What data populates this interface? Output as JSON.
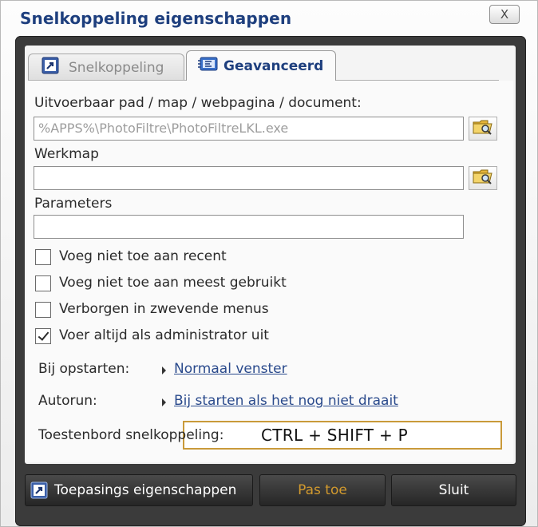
{
  "window": {
    "title": "Snelkoppeling eigenschappen",
    "close_label": "X"
  },
  "tabs": [
    {
      "label": "Snelkoppeling",
      "icon": "shortcut-arrow-icon",
      "active": false
    },
    {
      "label": "Geavanceerd",
      "icon": "advanced-settings-icon",
      "active": true
    }
  ],
  "fields": {
    "path_label": "Uitvoerbaar pad / map / webpagina / document:",
    "path_value": "%APPS%\\PhotoFiltre\\PhotoFiltreLKL.exe",
    "workdir_label": "Werkmap",
    "workdir_value": "",
    "params_label": "Parameters",
    "params_value": ""
  },
  "checkboxes": [
    {
      "label": "Voeg niet toe aan recent",
      "checked": false
    },
    {
      "label": "Voeg niet toe aan meest gebruikt",
      "checked": false
    },
    {
      "label": "Verborgen in zwevende menus",
      "checked": false
    },
    {
      "label": "Voer altijd als administrator uit",
      "checked": true
    }
  ],
  "options": {
    "startup_label": "Bij opstarten:",
    "startup_value": "Normaal venster",
    "autorun_label": "Autorun:",
    "autorun_value": "Bij starten als het nog niet draait",
    "hotkey_label": "Toestenbord snelkoppeling:",
    "hotkey_value": "CTRL + SHIFT + P"
  },
  "buttons": {
    "props_label": "Toepasings eigenschappen",
    "apply_label": "Pas toe",
    "close_label": "Sluit"
  },
  "colors": {
    "title": "#1e3f7e",
    "apply_text": "#d29a2e",
    "hotkey_border": "#c99a3a",
    "link": "#2a4a8c"
  }
}
